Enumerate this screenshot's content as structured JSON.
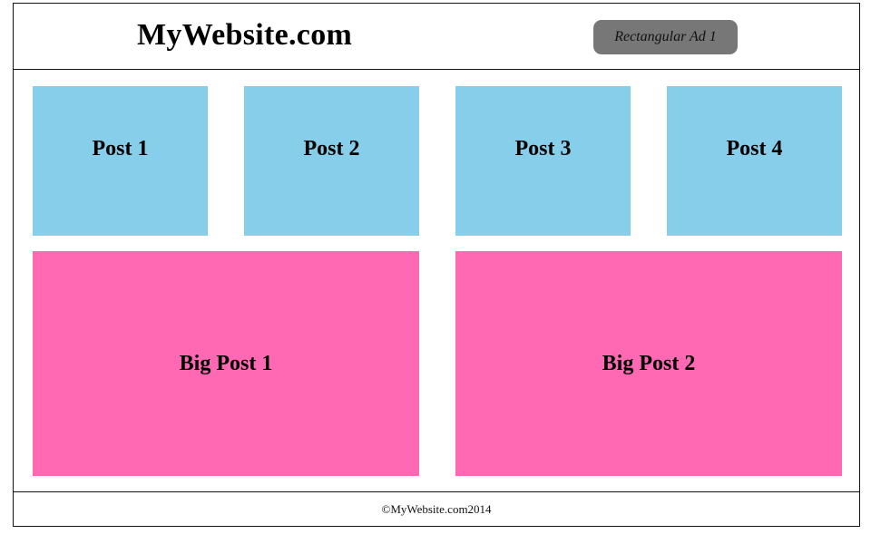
{
  "header": {
    "site_title": "MyWebsite.com",
    "ad_label": "Rectangular Ad 1"
  },
  "posts": [
    {
      "label": "Post 1"
    },
    {
      "label": "Post 2"
    },
    {
      "label": "Post 3"
    },
    {
      "label": "Post 4"
    }
  ],
  "big_posts": [
    {
      "label": "Big Post 1"
    },
    {
      "label": "Big Post 2"
    }
  ],
  "footer": {
    "copyright": "©MyWebsite.com2014"
  },
  "colors": {
    "post_bg": "#87ceeb",
    "big_post_bg": "#ff69b4",
    "ad_bg": "#777777"
  }
}
